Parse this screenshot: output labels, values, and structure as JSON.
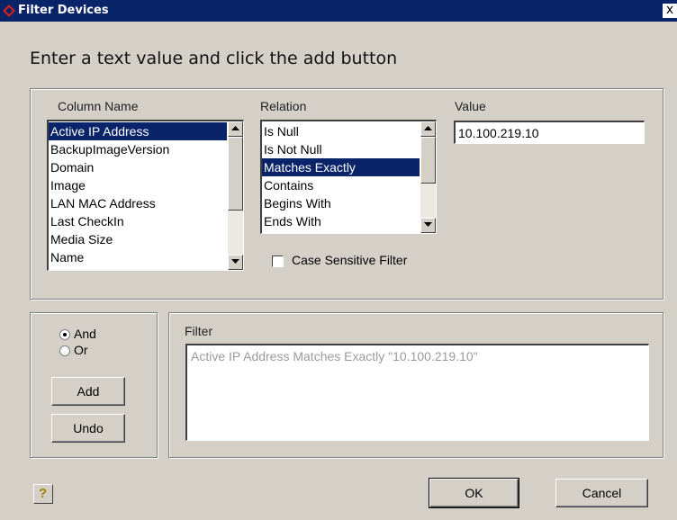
{
  "window": {
    "title": "Filter Devices",
    "close_symbol": "x",
    "icon": "app-logo-icon"
  },
  "instruction": "Enter a text value and click the add button",
  "column_name": {
    "label": "Column Name",
    "items": [
      "Active IP Address",
      "BackupImageVersion",
      "Domain",
      "Image",
      "LAN MAC Address",
      "Last CheckIn",
      "Media Size",
      "Name"
    ],
    "selected_index": 0
  },
  "relation": {
    "label": "Relation",
    "items": [
      "Is Null",
      "Is Not Null",
      "Matches Exactly",
      "Contains",
      "Begins With",
      "Ends With"
    ],
    "selected_index": 2
  },
  "value": {
    "label": "Value",
    "text": "10.100.219.10"
  },
  "case_sensitive": {
    "label": "Case Sensitive Filter",
    "checked": false
  },
  "logic": {
    "and_label": "And",
    "or_label": "Or",
    "selected": "And"
  },
  "buttons": {
    "add": "Add",
    "undo": "Undo",
    "ok": "OK",
    "cancel": "Cancel",
    "help": "?"
  },
  "filter": {
    "label": "Filter",
    "text": "Active IP Address Matches Exactly \"10.100.219.10\""
  },
  "colors": {
    "titlebar": "#0a246a",
    "selection": "#0a246a",
    "dialog_bg": "#d4d0c8"
  }
}
